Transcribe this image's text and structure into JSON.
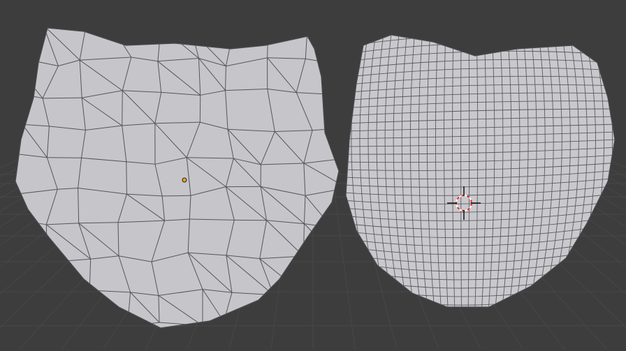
{
  "viewport": {
    "background_color": "#3d3d3d",
    "grid_color": "#474747",
    "mesh_color": "#c6c6ca",
    "edge_color": "#4a4a4e",
    "origin_color": "#f0a020",
    "cursor_ring_color": "#e03030"
  },
  "objects": [
    {
      "name_icon": "low-poly-cat-head-mesh"
    },
    {
      "name_icon": "subdivided-cat-head-mesh"
    }
  ],
  "icons": {
    "origin": "object-origin-icon",
    "cursor": "3d-cursor-icon"
  }
}
